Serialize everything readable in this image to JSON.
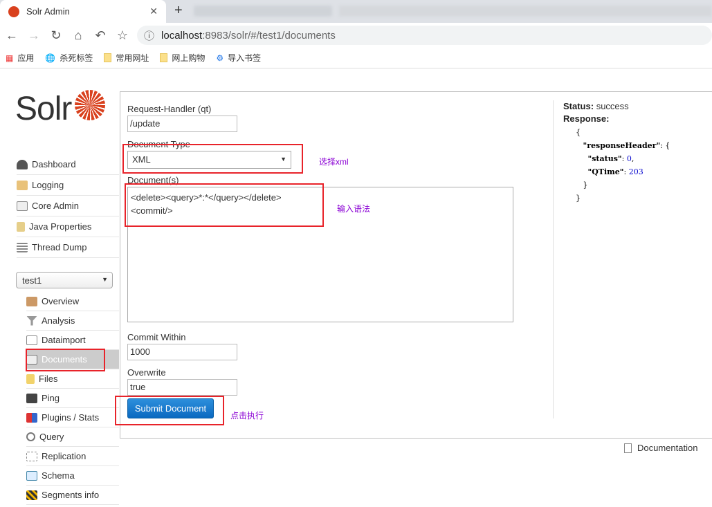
{
  "browser": {
    "tab_title": "Solr Admin",
    "url_host": "localhost",
    "url_path": ":8983/solr/#/test1/documents",
    "bookmarks": [
      "应用",
      "杀死标签",
      "常用网址",
      "网上购物",
      "导入书签"
    ]
  },
  "logo": "Solr",
  "sidebar": {
    "items": [
      "Dashboard",
      "Logging",
      "Core Admin",
      "Java Properties",
      "Thread Dump"
    ],
    "core_selected": "test1",
    "core_items": [
      "Overview",
      "Analysis",
      "Dataimport",
      "Documents",
      "Files",
      "Ping",
      "Plugins / Stats",
      "Query",
      "Replication",
      "Schema",
      "Segments info"
    ]
  },
  "form": {
    "handler_label": "Request-Handler (qt)",
    "handler_value": "/update",
    "doctype_label": "Document Type",
    "doctype_value": "XML",
    "docs_label": "Document(s)",
    "docs_value": "<delete><query>*:*</query></delete>\n<commit/>",
    "commit_label": "Commit Within",
    "commit_value": "1000",
    "overwrite_label": "Overwrite",
    "overwrite_value": "true",
    "submit_label": "Submit Document"
  },
  "annotations": {
    "select": "选择xml",
    "input": "输入语法",
    "click": "点击执行"
  },
  "response": {
    "status_label": "Status:",
    "status_value": "success",
    "response_label": "Response:",
    "header_key": "\"responseHeader\"",
    "status_key": "\"status\"",
    "status_num": "0",
    "qtime_key": "\"QTime\"",
    "qtime_num": "203"
  },
  "footer": {
    "documentation": "Documentation"
  },
  "colors": {
    "accent": "#d9411e",
    "button": "#0a69c0",
    "annotation": "#e8232a"
  }
}
